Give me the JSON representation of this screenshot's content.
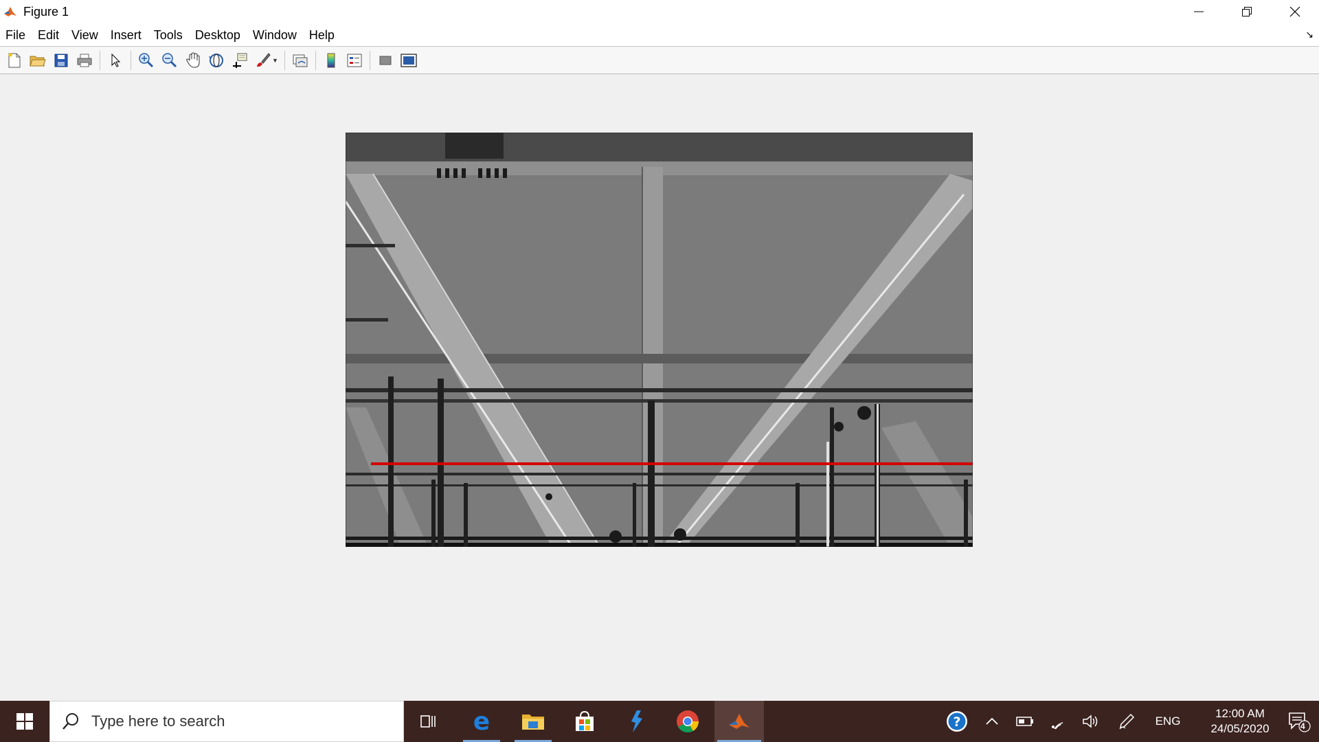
{
  "window": {
    "title": "Figure 1",
    "colors": {
      "titlebar": "#ffffff",
      "canvas": "#f0f0f0",
      "accent_red": "#d40000"
    }
  },
  "menu": {
    "items": [
      "File",
      "Edit",
      "View",
      "Insert",
      "Tools",
      "Desktop",
      "Window",
      "Help"
    ]
  },
  "toolbar": {
    "buttons": [
      "new-figure-icon",
      "open-file-icon",
      "save-icon",
      "print-icon",
      "edit-plot-arrow-icon",
      "zoom-in-icon",
      "zoom-out-icon",
      "pan-hand-icon",
      "rotate-3d-icon",
      "data-cursor-icon",
      "brush-icon",
      "link-plot-icon",
      "insert-colorbar-icon",
      "insert-legend-icon",
      "hide-plot-tools-icon",
      "show-plot-tools-icon"
    ]
  },
  "figure": {
    "image_description_hidden": "",
    "overlay_line_color": "#d40000"
  },
  "taskbar": {
    "search_placeholder": "Type here to search",
    "apps": [
      "task-view-icon",
      "edge-icon",
      "file-explorer-icon",
      "store-icon",
      "visual-studio-icon",
      "chrome-icon",
      "matlab-icon"
    ],
    "tray": {
      "language": "ENG",
      "time": "12:00 AM",
      "date": "24/05/2020",
      "notification_count": "4"
    }
  }
}
